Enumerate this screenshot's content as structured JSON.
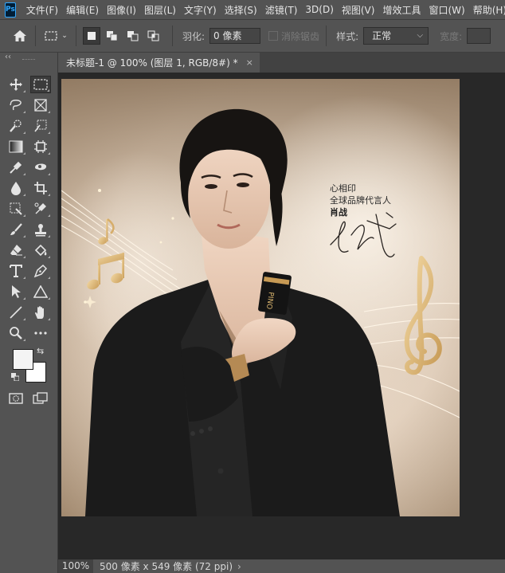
{
  "app": {
    "logo": "Ps"
  },
  "menu": [
    "文件(F)",
    "编辑(E)",
    "图像(I)",
    "图层(L)",
    "文字(Y)",
    "选择(S)",
    "滤镜(T)",
    "3D(D)",
    "视图(V)",
    "增效工具",
    "窗口(W)",
    "帮助(H)"
  ],
  "options": {
    "feather_label": "羽化:",
    "feather_value": "0 像素",
    "antialias_label": "消除锯齿",
    "style_label": "样式:",
    "style_value": "正常",
    "width_label": "宽度:"
  },
  "toolbar": {
    "collapse": "‹‹"
  },
  "document": {
    "tab_title": "未标题-1 @ 100% (图层 1, RGB/8#) *",
    "close": "×",
    "poster": {
      "line1": "心相印",
      "line2": "全球品牌代言人",
      "line3": "肖战",
      "product_text": "PINO"
    }
  },
  "status": {
    "zoom": "100%",
    "info": "500 像素 x 549 像素 (72 ppi)",
    "arrow": "›"
  },
  "colors": {
    "foreground": "#f4f4f4",
    "background": "#ffffff",
    "accent_gold": "#d9b46e"
  }
}
